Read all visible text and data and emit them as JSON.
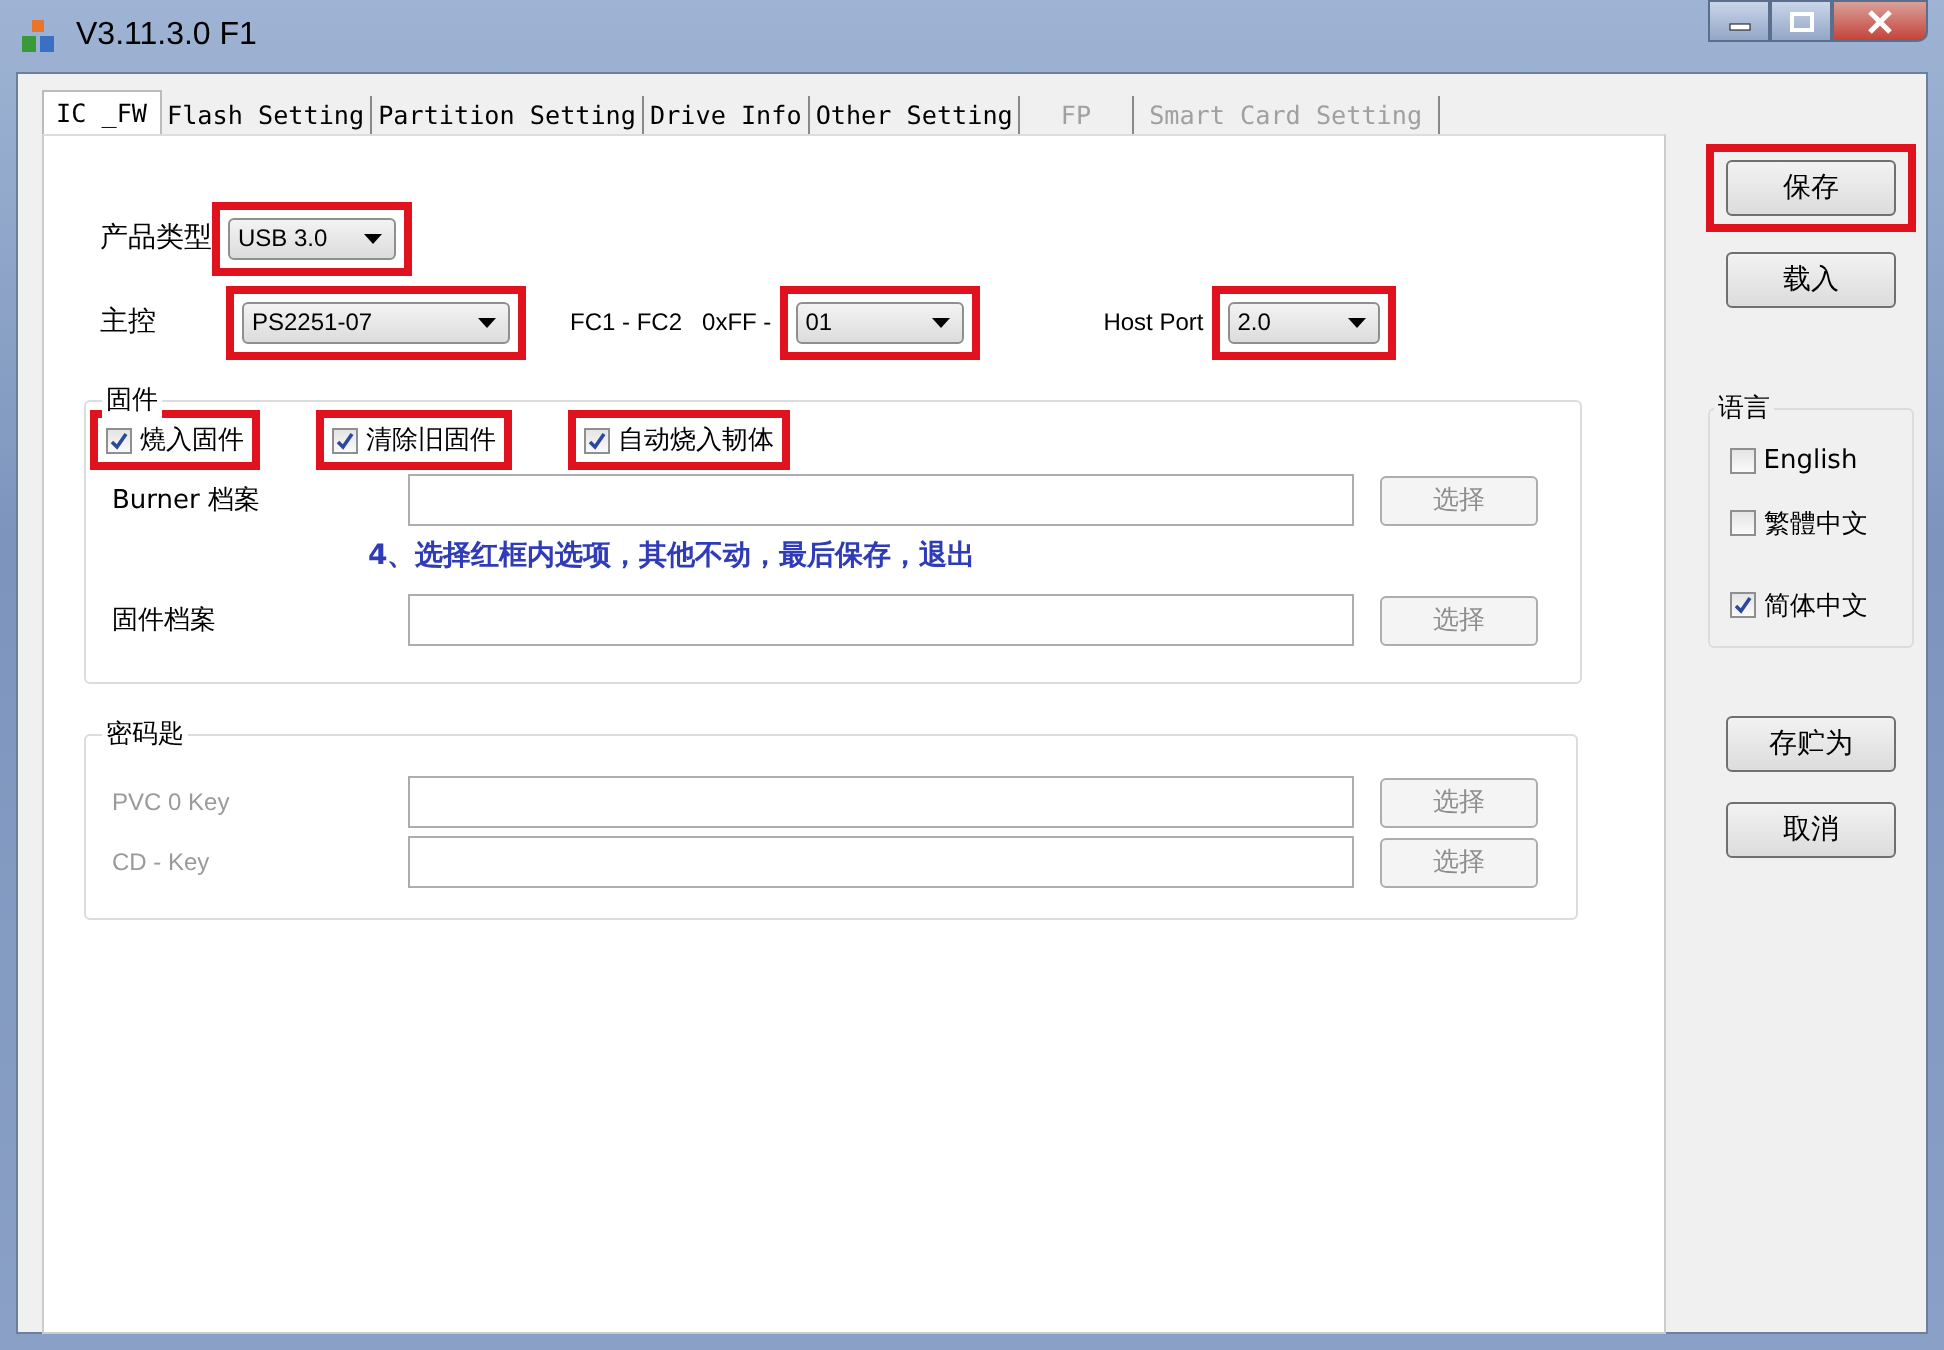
{
  "window": {
    "title": "V3.11.3.0 F1"
  },
  "tabs": [
    {
      "label": "IC _FW",
      "selected": true,
      "disabled": false
    },
    {
      "label": "Flash Setting",
      "selected": false,
      "disabled": false
    },
    {
      "label": "Partition Setting",
      "selected": false,
      "disabled": false
    },
    {
      "label": "Drive Info",
      "selected": false,
      "disabled": false
    },
    {
      "label": "Other Setting",
      "selected": false,
      "disabled": false
    },
    {
      "label": "FP",
      "selected": false,
      "disabled": true
    },
    {
      "label": "Smart Card Setting",
      "selected": false,
      "disabled": true
    }
  ],
  "product_type": {
    "label": "产品类型",
    "value": "USB 3.0",
    "highlighted": true
  },
  "controller": {
    "label": "主控",
    "value": "PS2251-07",
    "highlighted": true
  },
  "fc_range": {
    "label": "FC1 - FC2",
    "prefix": "0xFF -",
    "value": "01",
    "highlighted": true
  },
  "host_port": {
    "label": "Host Port",
    "value": "2.0",
    "highlighted": true
  },
  "firmware_group": {
    "title": "固件",
    "options": [
      {
        "label": "燒入固件",
        "checked": true,
        "highlighted": true
      },
      {
        "label": "清除旧固件",
        "checked": true,
        "highlighted": true
      },
      {
        "label": "自动烧入韧体",
        "checked": true,
        "highlighted": true
      }
    ],
    "files": [
      {
        "label": "Burner 档案",
        "button": "选择",
        "disabled": true
      },
      {
        "label": "固件档案",
        "button": "选择",
        "disabled": true
      }
    ],
    "note": "4、选择红框内选项，其他不动，最后保存，退出"
  },
  "key_group": {
    "title": "密码匙",
    "fields": [
      {
        "label": "PVC 0 Key",
        "button": "选择",
        "disabled": true
      },
      {
        "label": "CD - Key",
        "button": "选择",
        "disabled": true
      }
    ]
  },
  "buttons_top": [
    {
      "label": "保存",
      "highlighted": true
    },
    {
      "label": "载入",
      "highlighted": false
    }
  ],
  "language_group": {
    "title": "语言",
    "options": [
      {
        "label": "English",
        "checked": false
      },
      {
        "label": "繁體中文",
        "checked": false
      },
      {
        "label": "简体中文",
        "checked": true
      }
    ]
  },
  "buttons_bottom": [
    {
      "label": "存贮为"
    },
    {
      "label": "取消"
    }
  ]
}
